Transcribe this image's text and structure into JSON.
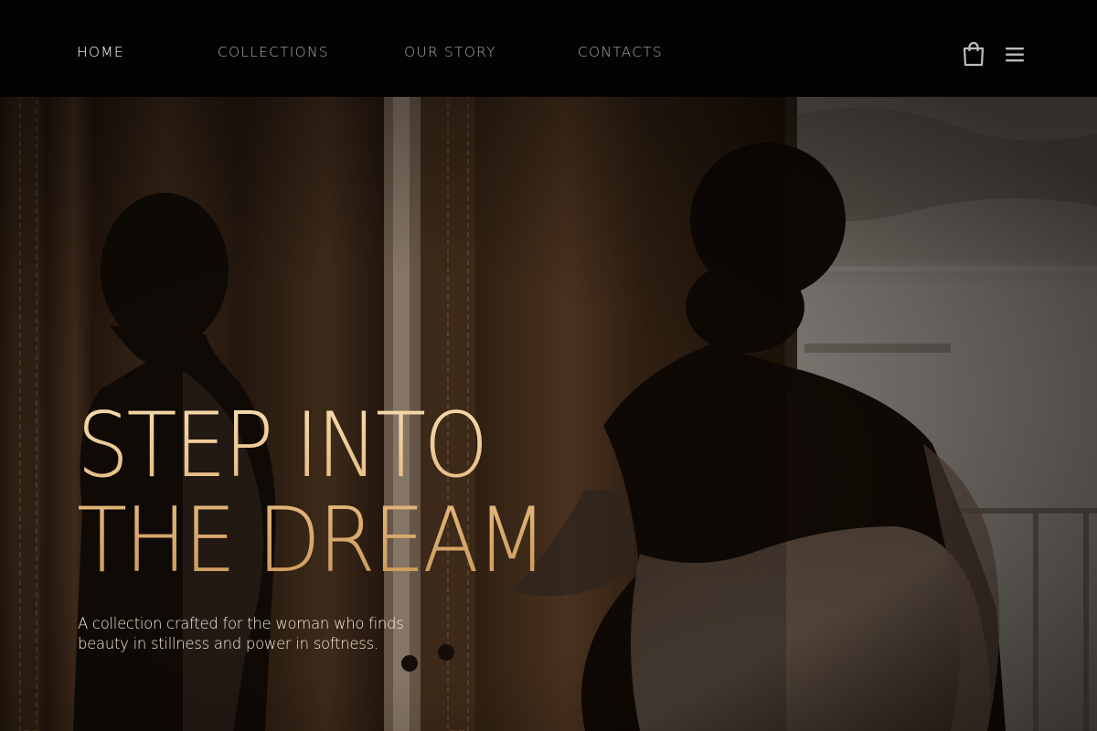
{
  "nav": {
    "items": [
      {
        "label": "HOME",
        "active": true
      },
      {
        "label": "COLLECTIONS",
        "active": false
      },
      {
        "label": "OUR STORY",
        "active": false
      },
      {
        "label": "CONTACTS",
        "active": false
      }
    ],
    "icons": [
      "shopping-bag-icon",
      "hamburger-menu-icon"
    ]
  },
  "hero": {
    "headline_line1": "STEP INTO",
    "headline_line2": "THE DREAM",
    "subtitle": "A collection crafted for the woman who finds beauty in stillness and power in softness."
  },
  "colors": {
    "header_bg": "#030303",
    "nav_active": "#ffffff",
    "nav_inactive": "#a7a7a7",
    "headline_gold": "#e8c28c",
    "subtitle": "#f4ead8"
  }
}
